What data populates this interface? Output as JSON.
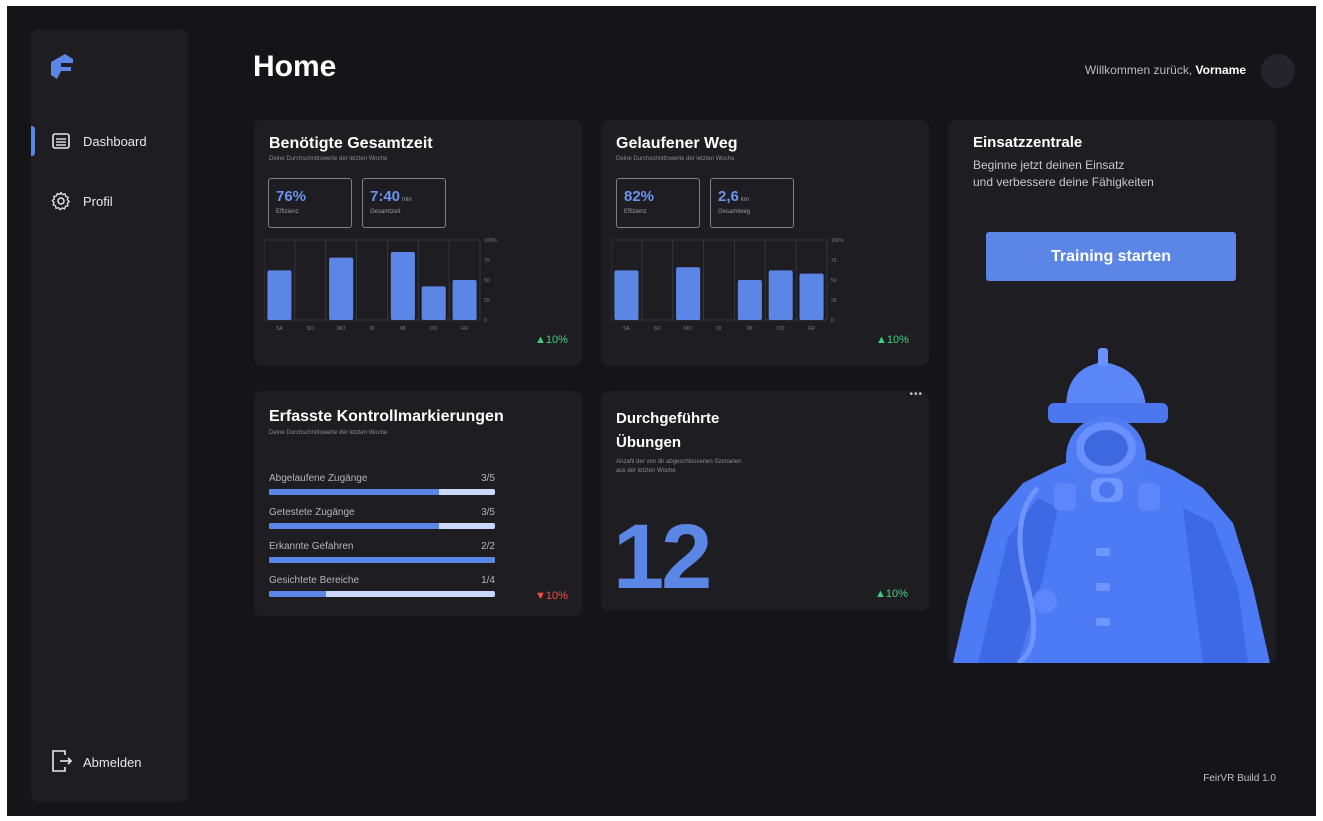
{
  "app": {
    "title": "Home",
    "build": "FeirVR Build 1.0"
  },
  "header": {
    "welcome_prefix": "Willkommen zurück, ",
    "username": "Vorname"
  },
  "sidebar": {
    "items": [
      {
        "label": "Dashboard",
        "icon": "dashboard-icon",
        "active": true
      },
      {
        "label": "Profil",
        "icon": "gear-icon",
        "active": false
      }
    ],
    "logout_label": "Abmelden"
  },
  "colors": {
    "accent": "#5b86e5",
    "background": "#151519",
    "card": "#1e1e22",
    "trend_up": "#3bd17a",
    "trend_down": "#ff4a4a"
  },
  "cards": {
    "time": {
      "title": "Benötigte Gesamtzeit",
      "subtitle": "Deine Durchschnittswerte der letzten Woche",
      "stat1": {
        "value": "76%",
        "label": "Effizienz"
      },
      "stat2": {
        "value": "7:40",
        "unit": "min",
        "label": "Gesamtzeit"
      },
      "trend": "▲10%"
    },
    "distance": {
      "title": "Gelaufener Weg",
      "subtitle": "Deine Durchschnittswerte der letzten Woche",
      "stat1": {
        "value": "82%",
        "label": "Effizienz"
      },
      "stat2": {
        "value": "2,6",
        "unit": "km",
        "label": "Gesamtweg"
      },
      "trend": "▲10%"
    },
    "markers": {
      "title": "Erfasste Kontrollmarkierungen",
      "subtitle": "Deine Durchschnittswerte der letzten Woche",
      "rows": [
        {
          "label": "Abgelaufene Zugänge",
          "value": "3/5",
          "fraction": 0.75
        },
        {
          "label": "Getestete Zugänge",
          "value": "3/5",
          "fraction": 0.75
        },
        {
          "label": "Erkannte Gefahren",
          "value": "2/2",
          "fraction": 1.0
        },
        {
          "label": "Gesichtete Bereiche",
          "value": "1/4",
          "fraction": 0.25
        }
      ],
      "trend": "▼10%"
    },
    "exercises": {
      "title_line1": "Durchgeführte",
      "title_line2": "Übungen",
      "subtitle_line1": "Anzahl der von dir abgeschlossenen Szenarien",
      "subtitle_line2": "aus der letzten Woche",
      "value": "12",
      "trend": "▲10%",
      "menu": "•••"
    },
    "cta": {
      "title": "Einsatzzentrale",
      "line1": "Beginne jetzt deinen Einsatz",
      "line2": "und verbessere deine Fähigkeiten",
      "button": "Training starten"
    }
  },
  "chart_data": [
    {
      "type": "bar",
      "title": "Benötigte Gesamtzeit",
      "categories": [
        "SA",
        "SO",
        "MO",
        "DI",
        "MI",
        "DO",
        "FR"
      ],
      "values": [
        62,
        0,
        78,
        0,
        85,
        42,
        50
      ],
      "ylim": [
        0,
        100
      ],
      "yticks": [
        "100%",
        "75",
        "50",
        "25",
        "0"
      ],
      "grid": true
    },
    {
      "type": "bar",
      "title": "Gelaufener Weg",
      "categories": [
        "SA",
        "SO",
        "MO",
        "DI",
        "MI",
        "DO",
        "FR"
      ],
      "values": [
        62,
        0,
        66,
        0,
        50,
        62,
        58
      ],
      "ylim": [
        0,
        100
      ],
      "yticks": [
        "100%",
        "75",
        "50",
        "25",
        "0"
      ],
      "grid": true
    }
  ]
}
